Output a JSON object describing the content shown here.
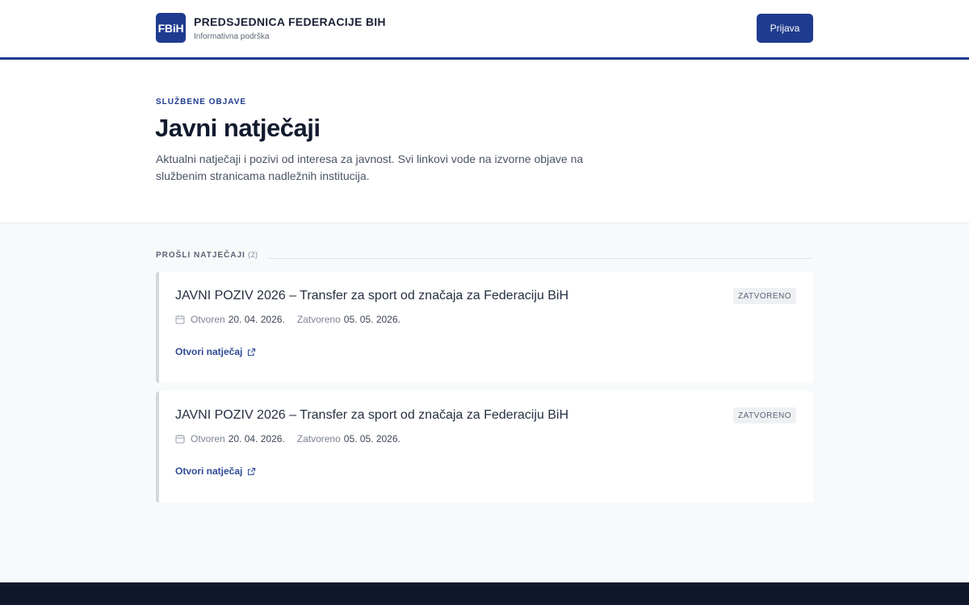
{
  "header": {
    "logo_text": "FBiH",
    "brand_title": "PREDSJEDNICA FEDERACIJE BIH",
    "brand_subtitle": "Informativna podrška",
    "login_label": "Prijava"
  },
  "hero": {
    "eyebrow": "SLUŽBENE OBJAVE",
    "title": "Javni natječaji",
    "description": "Aktualni natječaji i pozivi od interesa za javnost. Svi linkovi vode na izvorne objave na službenim stranicama nadležnih institucija."
  },
  "section": {
    "label": "PROŠLI NATJEČAJI",
    "count": "(2)"
  },
  "cards": [
    {
      "title": "JAVNI POZIV 2026 – Transfer za sport od značaja za Federaciju BiH",
      "status": "ZATVORENO",
      "opened_label": "Otvoren",
      "opened_date": "20. 04. 2026.",
      "closed_label": "Zatvoreno",
      "closed_date": "05. 05. 2026.",
      "link_label": "Otvori natječaj"
    },
    {
      "title": "JAVNI POZIV 2026 – Transfer za sport od značaja za Federaciju BiH",
      "status": "ZATVORENO",
      "opened_label": "Otvoren",
      "opened_date": "20. 04. 2026.",
      "closed_label": "Zatvoreno",
      "closed_date": "05. 05. 2026.",
      "link_label": "Otvori natječaj"
    }
  ],
  "colors": {
    "brand": "#1f3b8f",
    "footer": "#0f172a"
  },
  "icons": [
    "calendar-icon",
    "external-link-icon"
  ]
}
